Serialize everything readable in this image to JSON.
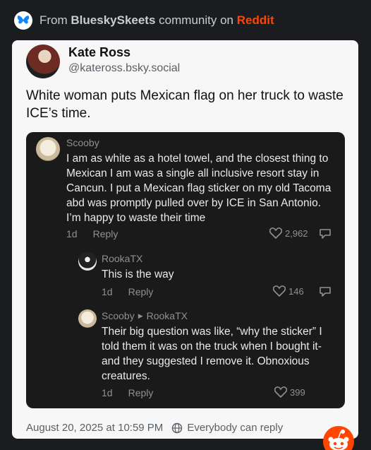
{
  "header": {
    "prefix": "From",
    "community": "BlueskySkeets",
    "middle": "community on",
    "platform": "Reddit",
    "icon": "bluesky-butterfly-icon"
  },
  "post": {
    "author_name": "Kate Ross",
    "author_handle": "@kateross.bsky.social",
    "text": "White woman puts Mexican flag on her truck to waste ICE’s time.",
    "timestamp": "August 20, 2025 at 10:59 PM",
    "reply_setting": "Everybody can reply"
  },
  "comments": [
    {
      "user": "Scooby",
      "text": "I am as white as a hotel towel, and the closest thing to Mexican I am was a single all inclusive resort stay in Cancun. I put a Mexican flag sticker on my old Tacoma abd was promptly pulled over by ICE in San Antonio. I’m happy to waste their time",
      "age": "1d",
      "reply_label": "Reply",
      "votes": "2,962"
    },
    {
      "user": "RookaTX",
      "text": "This is the way",
      "age": "1d",
      "reply_label": "Reply",
      "votes": "146"
    },
    {
      "user": "Scooby",
      "reply_to": "RookaTX",
      "text": "Their big question was like, “why the sticker” I told them it was on the truck when I bought it- and they suggested I remove it. Obnoxious creatures.",
      "age": "1d",
      "reply_label": "Reply",
      "votes": "399"
    }
  ],
  "colors": {
    "reddit_orange": "#ff4500",
    "bluesky_blue": "#1185fe",
    "thread_bg": "#1a1a1b",
    "card_bg": "#f7f7f7"
  }
}
